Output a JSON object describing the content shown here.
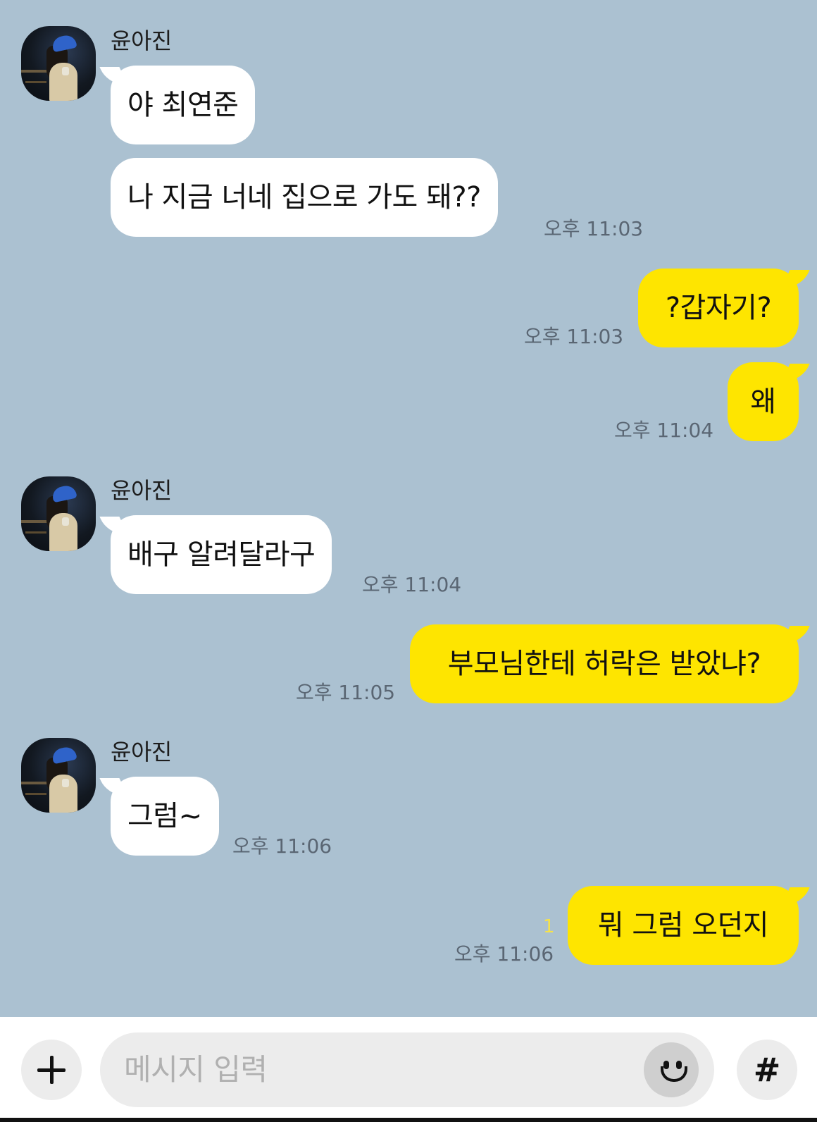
{
  "colors": {
    "background": "#abc1d1",
    "incoming_bubble": "#ffffff",
    "outgoing_bubble": "#fee500",
    "timestamp": "#5a6673",
    "unread_count": "#f6e24a"
  },
  "messages": [
    {
      "direction": "in",
      "sender": "윤아진",
      "text": "야 최연준",
      "time": ""
    },
    {
      "direction": "in",
      "sender": "",
      "text": "나 지금 너네 집으로 가도 돼??",
      "time": "오후 11:03"
    },
    {
      "direction": "out",
      "text": "?갑자기?",
      "time": "오후 11:03"
    },
    {
      "direction": "out",
      "text": "왜",
      "time": "오후 11:04"
    },
    {
      "direction": "in",
      "sender": "윤아진",
      "text": "배구 알려달라구",
      "time": "오후 11:04"
    },
    {
      "direction": "out",
      "text": "부모님한테 허락은 받았냐?",
      "time": "오후 11:05"
    },
    {
      "direction": "in",
      "sender": "윤아진",
      "text": "그럼~",
      "time": "오후 11:06"
    },
    {
      "direction": "out",
      "text": "뭐 그럼 오던지",
      "time": "오후 11:06",
      "unread": "1"
    }
  ],
  "input_bar": {
    "placeholder": "메시지 입력",
    "plus_icon": "plus-icon",
    "emoji_icon": "emoji-icon",
    "hash_label": "#"
  }
}
